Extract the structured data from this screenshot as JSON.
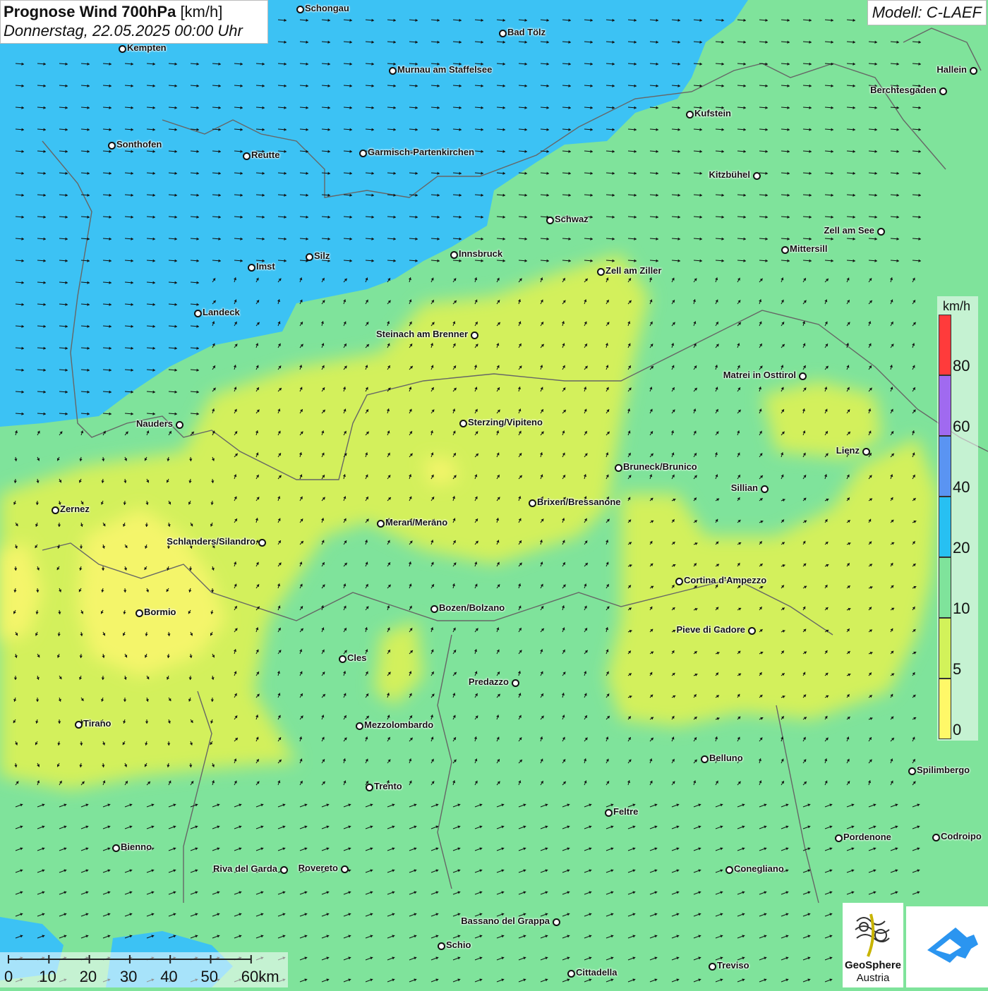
{
  "header": {
    "title_bold": "Prognose Wind 700hPa",
    "title_unit": "[km/h]",
    "subtitle": "Donnerstag, 22.05.2025 00:00 Uhr",
    "model": "Modell: C-LAEF"
  },
  "legend": {
    "unit": "km/h",
    "ticks": [
      "80",
      "60",
      "40",
      "20",
      "10",
      "5",
      "0"
    ],
    "colors": [
      "#ff3b3b",
      "#a06af0",
      "#5a94f2",
      "#27c0f2",
      "#7fe39b",
      "#d2f25a",
      "#fff868"
    ]
  },
  "scale_bar": {
    "labels": [
      "0",
      "10",
      "20",
      "30",
      "40",
      "50",
      "60km"
    ]
  },
  "map_colors": {
    "north_zone": "#3cc2f4",
    "mid_zone": "#7fe39b",
    "weak_zone": "#d3f05c",
    "calm_zone": "#f4f56a"
  },
  "cities": [
    {
      "name": "Schongau"
    },
    {
      "name": "Bad Tölz"
    },
    {
      "name": "Kempten"
    },
    {
      "name": "Murnau am Staffelsee"
    },
    {
      "name": "Hallein"
    },
    {
      "name": "Berchtesgaden"
    },
    {
      "name": "Kufstein"
    },
    {
      "name": "Sonthofen"
    },
    {
      "name": "Reutte"
    },
    {
      "name": "Garmisch-Partenkirchen"
    },
    {
      "name": "Kitzbühel"
    },
    {
      "name": "Schwaz"
    },
    {
      "name": "Zell am See"
    },
    {
      "name": "Innsbruck"
    },
    {
      "name": "Mittersill"
    },
    {
      "name": "Imst"
    },
    {
      "name": "Silz"
    },
    {
      "name": "Zell am Ziller"
    },
    {
      "name": "Landeck"
    },
    {
      "name": "Steinach am Brenner"
    },
    {
      "name": "Matrei in Osttirol"
    },
    {
      "name": "Nauders"
    },
    {
      "name": "Sterzing/Vipiteno"
    },
    {
      "name": "Lienz"
    },
    {
      "name": "Bruneck/Brunico"
    },
    {
      "name": "Sillian"
    },
    {
      "name": "Zernez"
    },
    {
      "name": "Brixen/Bressanone"
    },
    {
      "name": "Meran/Merano"
    },
    {
      "name": "Schlanders/Silandro"
    },
    {
      "name": "Cortina d'Ampezzo"
    },
    {
      "name": "Bozen/Bolzano"
    },
    {
      "name": "Bormio"
    },
    {
      "name": "Pieve di Cadore"
    },
    {
      "name": "Cles"
    },
    {
      "name": "Predazzo"
    },
    {
      "name": "Tirano"
    },
    {
      "name": "Mezzolombardo"
    },
    {
      "name": "Belluno"
    },
    {
      "name": "Spilimbergo"
    },
    {
      "name": "Trento"
    },
    {
      "name": "Feltre"
    },
    {
      "name": "Pordenone"
    },
    {
      "name": "Codroipo"
    },
    {
      "name": "Bienno"
    },
    {
      "name": "Riva del Garda"
    },
    {
      "name": "Rovereto"
    },
    {
      "name": "Conegliano"
    },
    {
      "name": "Bassano del Grappa"
    },
    {
      "name": "Schio"
    },
    {
      "name": "Treviso"
    },
    {
      "name": "Cittadella"
    }
  ],
  "logo": {
    "name_line1": "GeoSphere",
    "name_line2": "Austria"
  }
}
